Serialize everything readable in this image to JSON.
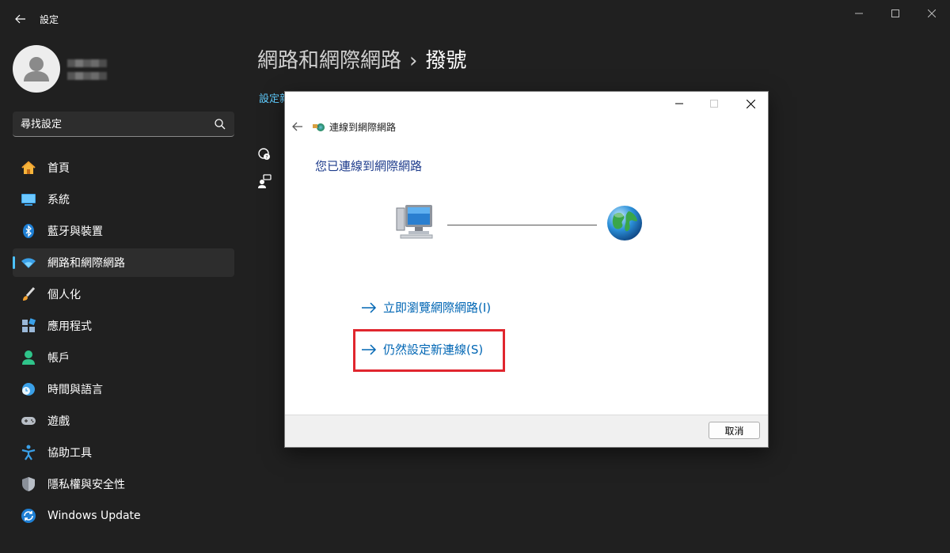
{
  "window": {
    "title": "設定"
  },
  "search": {
    "placeholder": "尋找設定"
  },
  "nav": {
    "items": [
      {
        "label": "首頁"
      },
      {
        "label": "系統"
      },
      {
        "label": "藍牙與裝置"
      },
      {
        "label": "網路和網際網路"
      },
      {
        "label": "個人化"
      },
      {
        "label": "應用程式"
      },
      {
        "label": "帳戶"
      },
      {
        "label": "時間與語言"
      },
      {
        "label": "遊戲"
      },
      {
        "label": "協助工具"
      },
      {
        "label": "隱私權與安全性"
      },
      {
        "label": "Windows Update"
      }
    ]
  },
  "main": {
    "breadcrumb_parent": "網路和網際網路",
    "breadcrumb_separator": "›",
    "breadcrumb_current": "撥號",
    "link_partial": "設定新"
  },
  "dialog": {
    "title": "連線到網際網路",
    "heading": "您已連線到網際網路",
    "option_browse": "立即瀏覽網際網路(I)",
    "option_setup": "仍然設定新連線(S)",
    "cancel": "取消"
  },
  "colors": {
    "accent": "#4cc2ff",
    "link": "#0066b4",
    "highlight": "#e0262e",
    "heading": "#1e3c8c"
  }
}
